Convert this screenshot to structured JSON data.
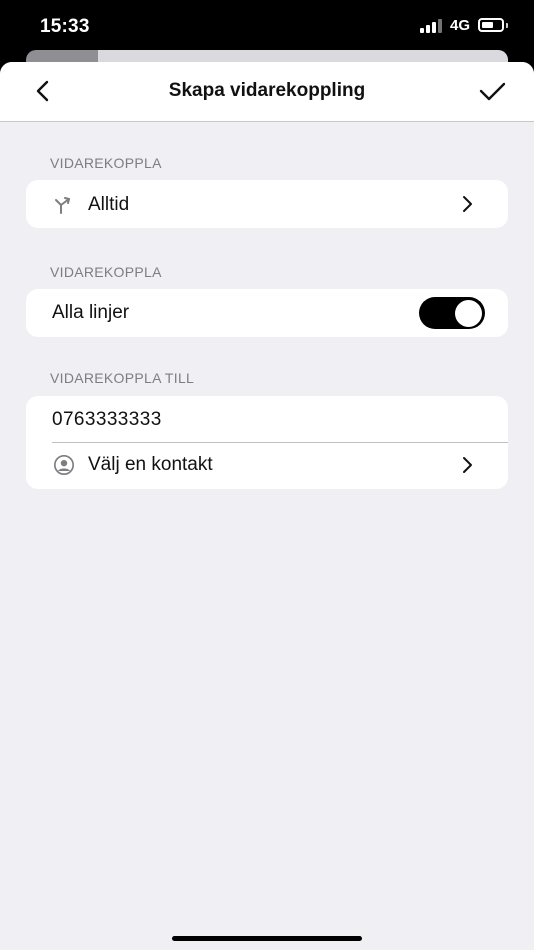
{
  "status_bar": {
    "time": "15:33",
    "network": "4G"
  },
  "nav": {
    "title": "Skapa vidarekoppling",
    "back_icon": "chevron-left-icon",
    "done_icon": "checkmark-icon"
  },
  "sections": [
    {
      "header": "VIDAREKOPPLA",
      "row": {
        "icon": "forward-call-icon",
        "label": "Alltid"
      }
    },
    {
      "header": "VIDAREKOPPLA",
      "row": {
        "label": "Alla linjer",
        "toggle_on": true
      }
    },
    {
      "header": "VIDAREKOPPLA TILL",
      "phone_value": "0763333333",
      "contact_row": {
        "icon": "person-circle-icon",
        "label": "Välj en kontakt"
      }
    }
  ],
  "colors": {
    "background": "#efeff4",
    "card": "#ffffff",
    "section_header": "#7d7d82",
    "toggle_on": "#000000"
  }
}
